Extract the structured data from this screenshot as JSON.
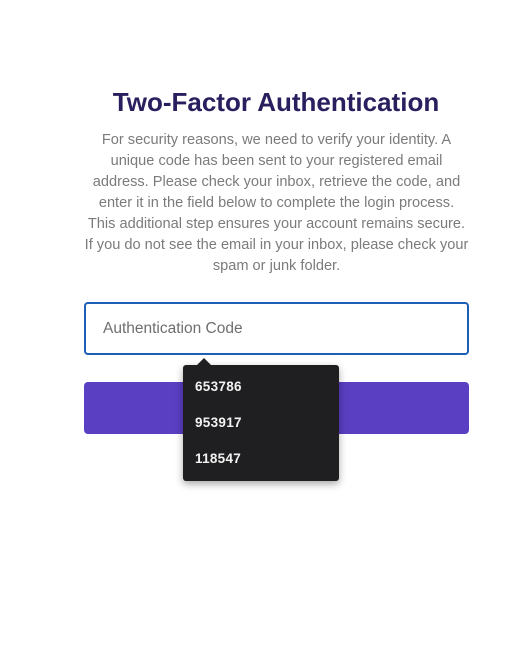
{
  "page": {
    "title": "Two-Factor Authentication",
    "description": "For security reasons, we need to verify your identity. A unique code has been sent to your registered email address. Please check your inbox, retrieve the code, and enter it in the field below to complete the login process. This additional step ensures your account remains secure. If you do not see the email in your inbox, please check your spam or junk folder."
  },
  "form": {
    "code_input": {
      "value": "",
      "placeholder": "Authentication Code"
    },
    "submit_label": ""
  },
  "autofill": {
    "suggestions": [
      "653786",
      "953917",
      "118547"
    ]
  },
  "colors": {
    "title": "#2a1f5e",
    "input_border": "#1d5fb8",
    "button_bg": "#5b3fc2",
    "popup_bg": "#1f1f21"
  }
}
